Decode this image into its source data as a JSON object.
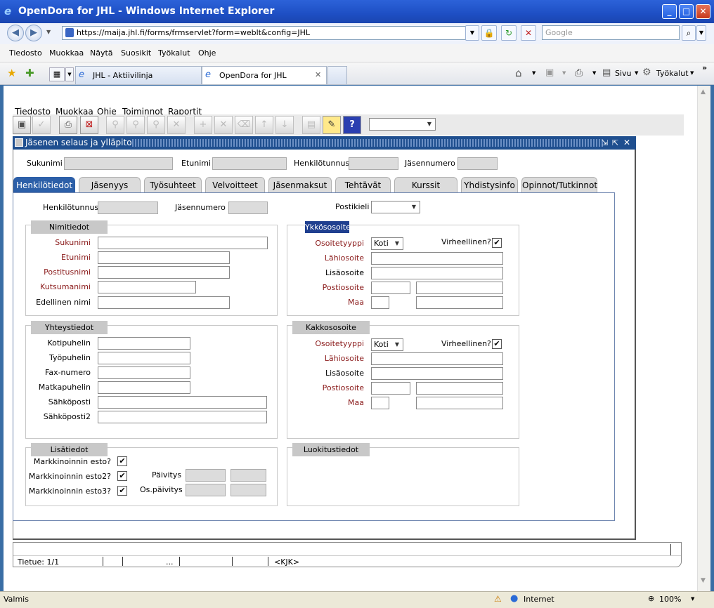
{
  "browser": {
    "title": "OpenDora for JHL - Windows Internet Explorer",
    "url": "https://maija.jhl.fi/forms/frmservlet?form=weblt&config=JHL",
    "search_placeholder": "Google",
    "menu": [
      "Tiedosto",
      "Muokkaa",
      "Näytä",
      "Suosikit",
      "Työkalut",
      "Ohje"
    ],
    "tabs": [
      {
        "label": "JHL - Aktiivilinja",
        "active": false
      },
      {
        "label": "OpenDora for JHL",
        "active": true
      }
    ],
    "cmd": {
      "sivu": "Sivu",
      "tyokalut": "Työkalut"
    },
    "status_left": "Valmis",
    "zone": "Internet",
    "zoom": "100%"
  },
  "app": {
    "menu": [
      "Tiedosto",
      "Muokkaa",
      "Ohje",
      "Toiminnot",
      "Raportit"
    ],
    "window_title": "Jäsenen selaus ja ylläpito",
    "search": {
      "sukunimi": "Sukunimi",
      "etunimi": "Etunimi",
      "henkilotunnus": "Henkilötunnus",
      "jasennumero": "Jäsennumero"
    },
    "tabs": [
      "Henkilötiedot",
      "Jäsenyys",
      "Työsuhteet",
      "Velvoitteet",
      "Jäsenmaksut",
      "Tehtävät",
      "Kurssit",
      "Yhdistysinfo",
      "Opinnot/Tutkinnot"
    ],
    "top": {
      "henkilotunnus": "Henkilötunnus",
      "jasennumero": "Jäsennumero",
      "postikieli": "Postikieli"
    },
    "nimitiedot": {
      "title": "Nimitiedot",
      "fields": [
        "Sukunimi",
        "Etunimi",
        "Postitusnimi",
        "Kutsumanimi",
        "Edellinen nimi"
      ]
    },
    "yhteystiedot": {
      "title": "Yhteystiedot",
      "fields": [
        "Kotipuhelin",
        "Työpuhelin",
        "Fax-numero",
        "Matkapuhelin",
        "Sähköposti",
        "Sähköposti2"
      ]
    },
    "lisatiedot": {
      "title": "Lisätiedot",
      "checks": [
        "Markkinoinnin esto?",
        "Markkinoinnin esto2?",
        "Markkinoinnin esto3?"
      ],
      "paivitys": "Päivitys",
      "ospaivitys": "Os.päivitys"
    },
    "ykkososoite": {
      "title": "Ykkösosoite",
      "tyyppi_label": "Osoitetyyppi",
      "tyyppi": "Koti",
      "virheellinen": "Virheellinen?",
      "lahiosoite": "Lähiosoite",
      "lisaosoite": "Lisäosoite",
      "postiosoite": "Postiosoite",
      "maa": "Maa"
    },
    "kakkososoite": {
      "title": "Kakkososoite",
      "tyyppi_label": "Osoitetyyppi",
      "tyyppi": "Koti",
      "virheellinen": "Virheellinen?",
      "lahiosoite": "Lähiosoite",
      "lisaosoite": "Lisäosoite",
      "postiosoite": "Postiosoite",
      "maa": "Maa"
    },
    "luokitustiedot": {
      "title": "Luokitustiedot"
    },
    "status": {
      "record": "Tietue: 1/1",
      "dots": "...",
      "kbd": "<KJK>"
    }
  }
}
